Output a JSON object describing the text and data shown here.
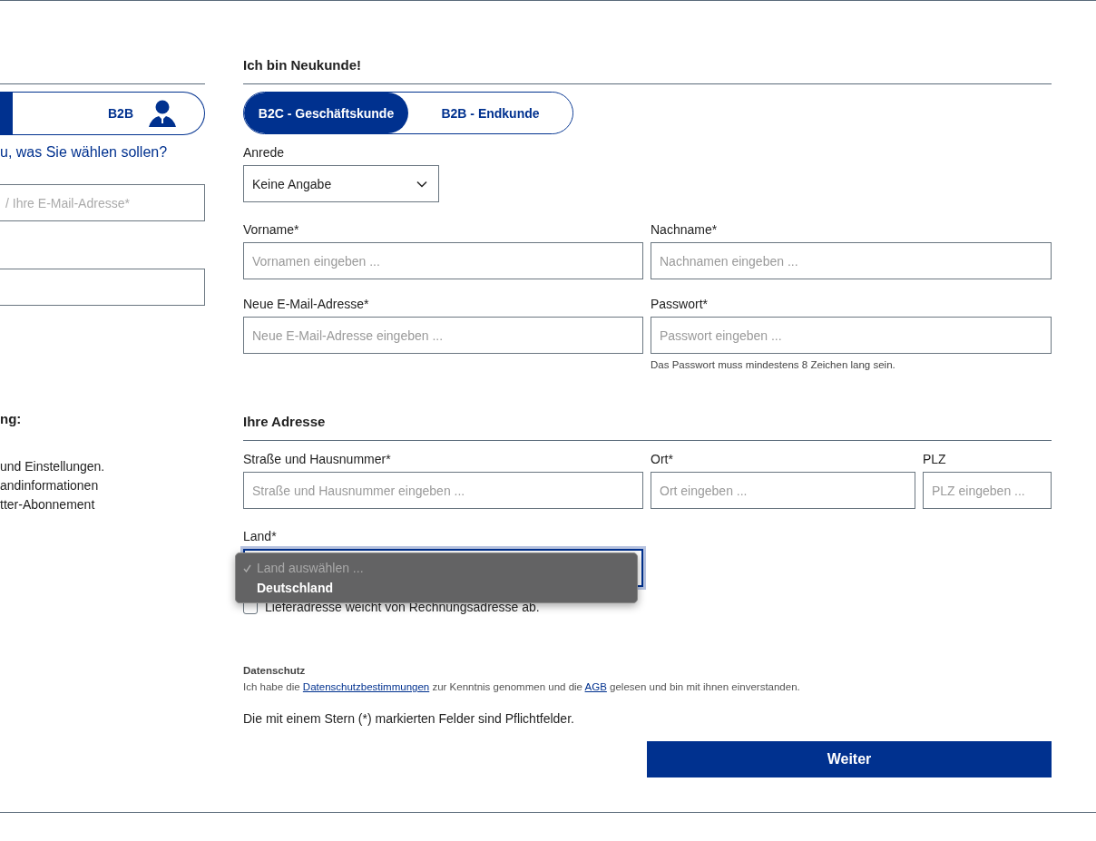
{
  "login_panel": {
    "customer_toggle": [
      {
        "selected": true
      },
      {
        "label": "B2B",
        "selected": false
      }
    ],
    "help_link": "u, was Sie wählen sollen?",
    "email_field": {
      "placeholder": "/ Ihre E-Mail-Adresse*"
    },
    "benefits_title": "ng:",
    "benefits": [
      "und Einstellungen.",
      "andinformationen",
      "tter-Abonnement"
    ]
  },
  "register_panel": {
    "title": "Ich bin Neukunde!",
    "customer_tabs": [
      {
        "label": "B2C - Geschäftskunde",
        "selected": true
      },
      {
        "label": "B2B - Endkunde",
        "selected": false
      }
    ],
    "salutation": {
      "label": "Anrede",
      "value": "Keine Angabe"
    },
    "personal_fields": [
      {
        "label": "Vorname*",
        "placeholder": "Vornamen eingeben ..."
      },
      {
        "label": "Nachname*",
        "placeholder": "Nachnamen eingeben ..."
      },
      {
        "label": "Neue E-Mail-Adresse*",
        "placeholder": "Neue E-Mail-Adresse eingeben ..."
      },
      {
        "label": "Passwort*",
        "placeholder": "Passwort eingeben ...",
        "hint": "Das Passwort muss mindestens 8 Zeichen lang sein."
      }
    ],
    "address_title": "Ihre Adresse",
    "address_fields": [
      {
        "label": "Straße und Hausnummer*",
        "placeholder": "Straße und Hausnummer eingeben ..."
      },
      {
        "label": "Ort*",
        "placeholder": "Ort eingeben ..."
      },
      {
        "label": "PLZ",
        "placeholder": "PLZ eingeben ..."
      }
    ],
    "country": {
      "label": "Land*",
      "expanded": true,
      "options": [
        {
          "label": "Land auswählen ...",
          "selected": true,
          "disabled": true
        },
        {
          "label": "Deutschland",
          "selected": false,
          "disabled": false
        }
      ]
    },
    "delivery_checkbox": {
      "label": "Lieferadresse weicht von Rechnungsadresse ab.",
      "checked": false
    },
    "privacy": {
      "title": "Datenschutz",
      "parts": [
        {
          "text": "Ich habe die "
        },
        {
          "text": "Datenschutzbestimmungen",
          "kind": "link"
        },
        {
          "text": " zur Kenntnis genommen und die "
        },
        {
          "text": "AGB",
          "kind": "link"
        },
        {
          "text": " gelesen und bin mit ihnen einverstanden."
        }
      ]
    },
    "required_note": "Die mit einem Stern (*) markierten Felder sind Pflichtfelder.",
    "submit_button": "Weiter"
  }
}
